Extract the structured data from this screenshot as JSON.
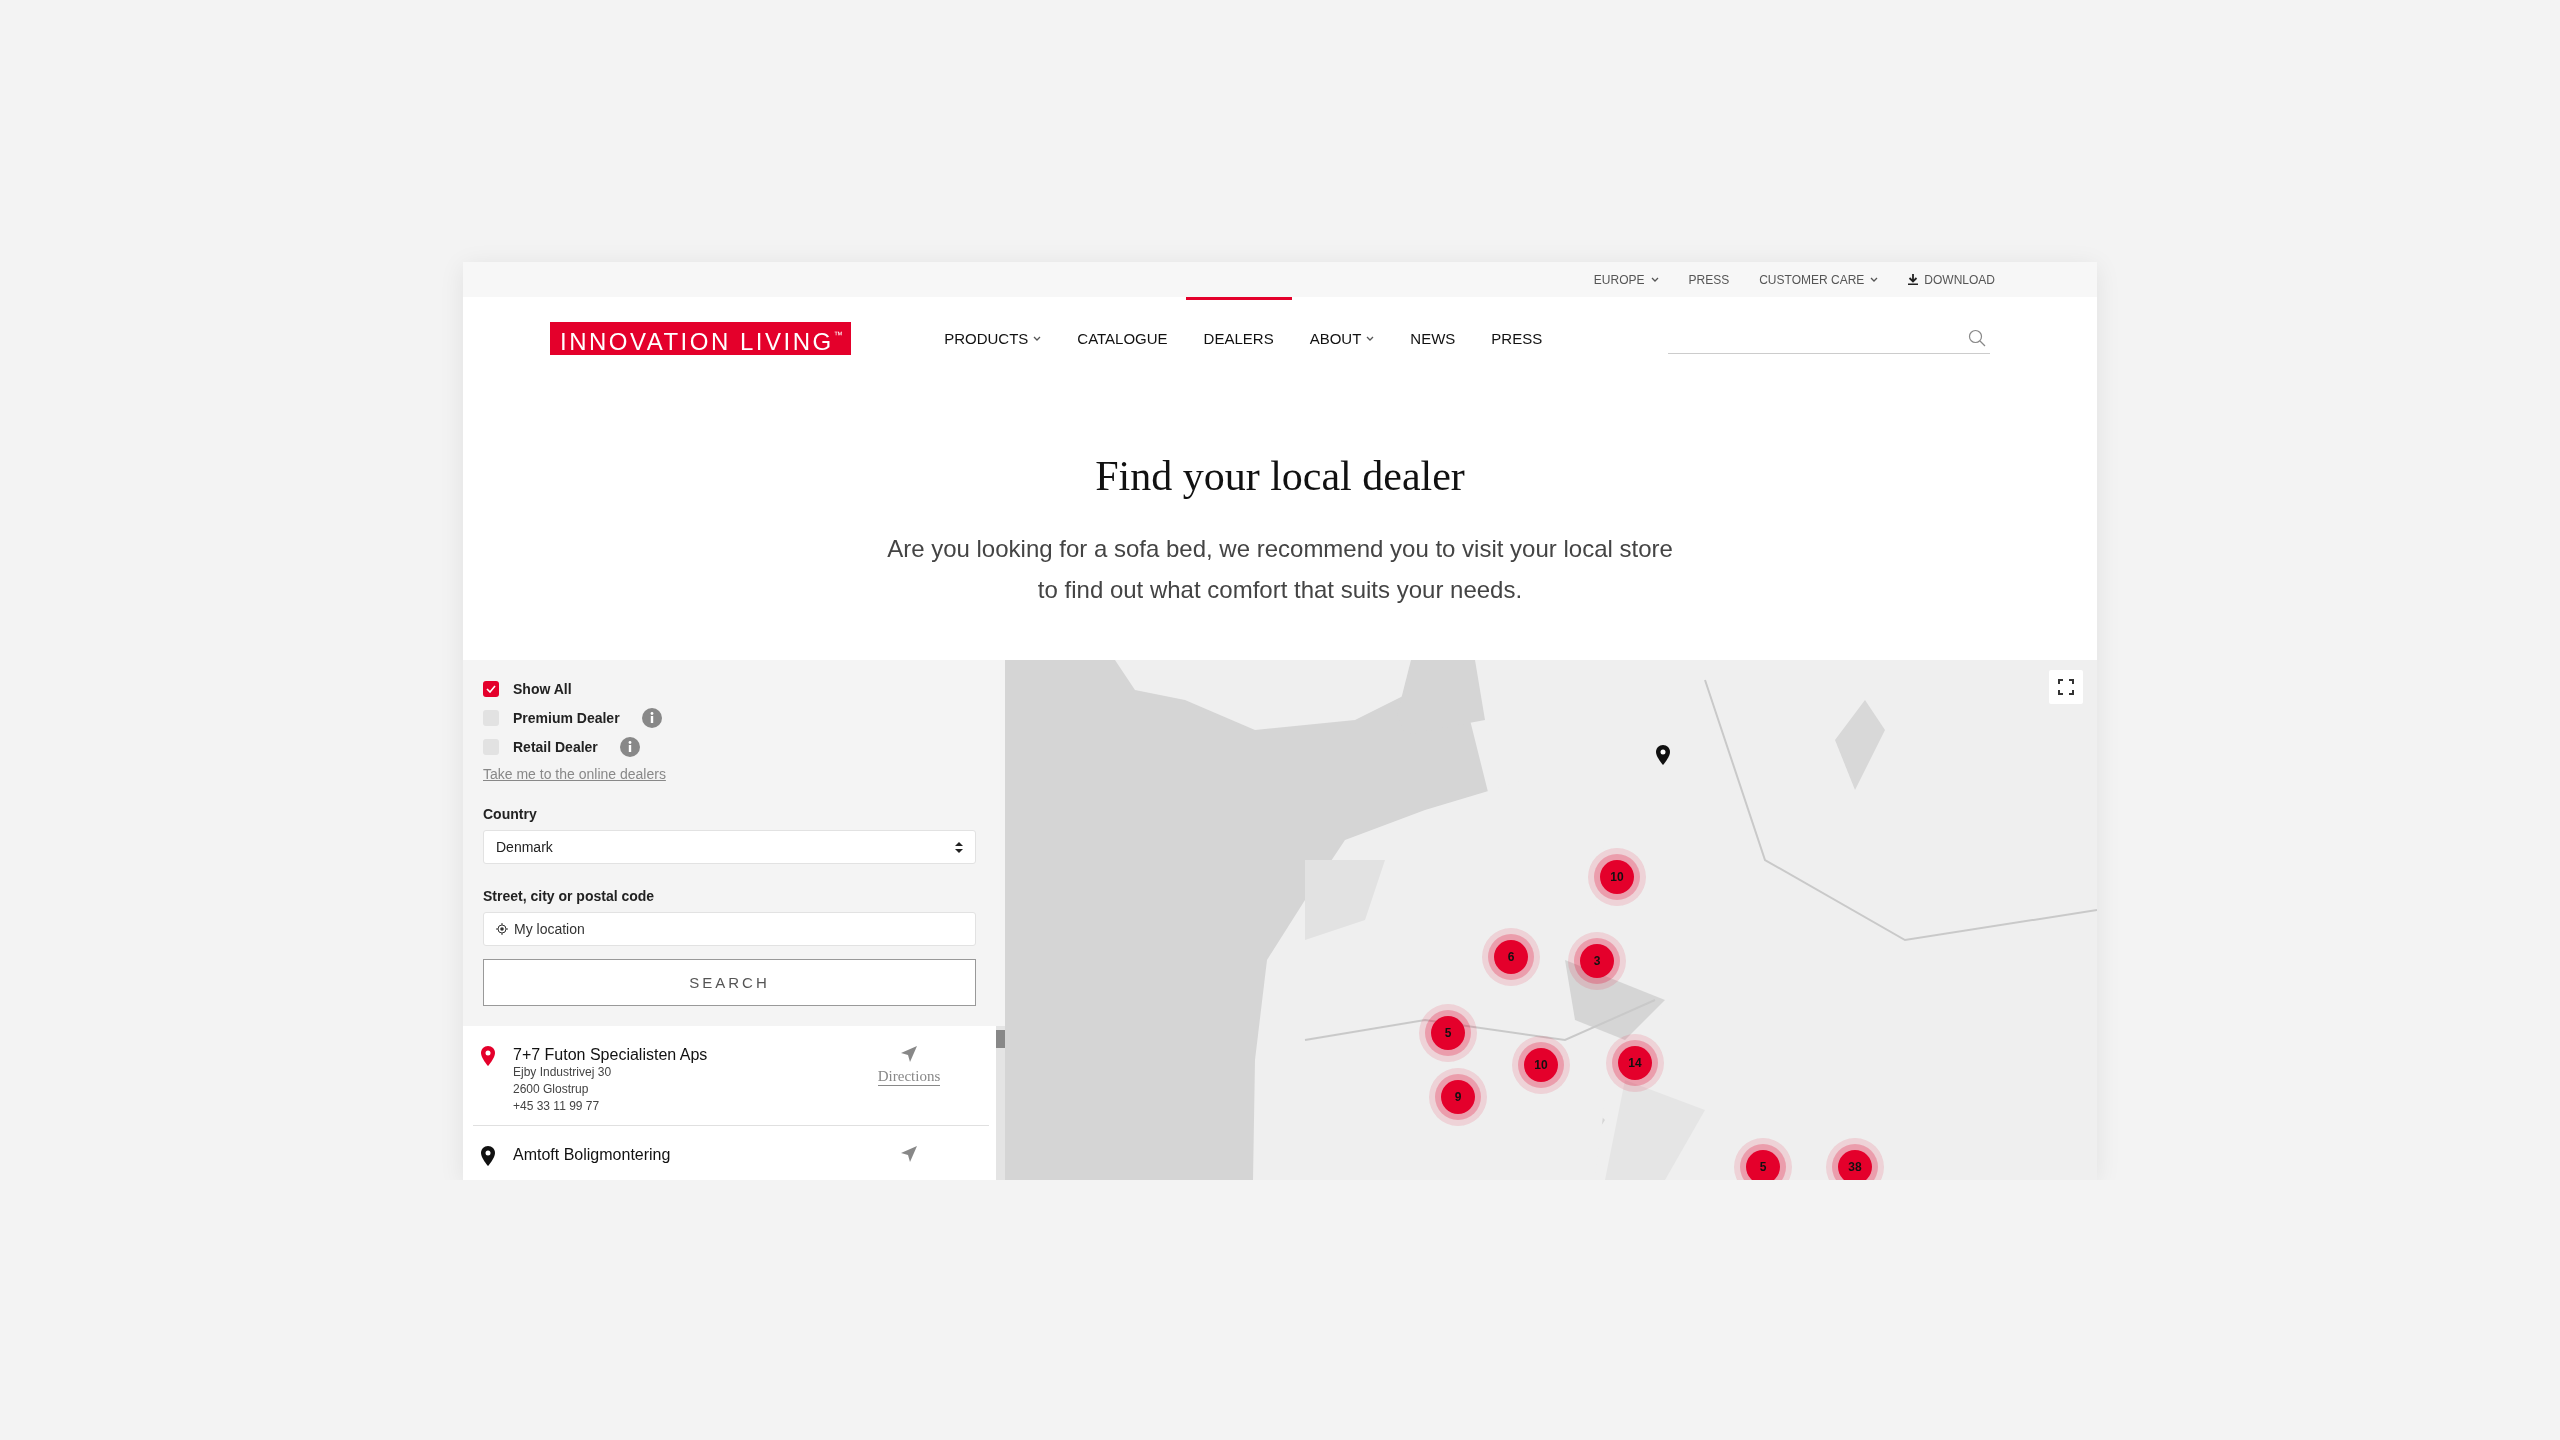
{
  "top_bar": {
    "links": [
      {
        "label": "EUROPE",
        "kind": "dropdown"
      },
      {
        "label": "PRESS",
        "kind": "link"
      },
      {
        "label": "CUSTOMER CARE",
        "kind": "dropdown"
      },
      {
        "label": "DOWNLOAD",
        "kind": "download"
      }
    ]
  },
  "nav": {
    "logo": "INNOVATION LIVING$^{™}$",
    "items": [
      {
        "label": "PRODUCTS",
        "dropdown": true,
        "selected": false
      },
      {
        "label": "CATALOGUE",
        "dropdown": false,
        "selected": false
      },
      {
        "label": "DEALERS",
        "dropdown": false,
        "selected": true
      },
      {
        "label": "ABOUT",
        "dropdown": true,
        "selected": false
      },
      {
        "label": "NEWS",
        "dropdown": false,
        "selected": false
      },
      {
        "label": "PRESS",
        "dropdown": false,
        "selected": false
      }
    ]
  },
  "hero": {
    "title": "Find your local dealer",
    "lines": [
      "Are you looking for a sofa bed, we recommend you to visit your local store",
      "to find out what comfort that suits your needs."
    ]
  },
  "filters": [
    {
      "label": "Show All",
      "checked": true,
      "info": false
    },
    {
      "label": "Premium Dealer",
      "checked": false,
      "info": true
    },
    {
      "label": "Retail Dealer",
      "checked": false,
      "info": true
    }
  ],
  "online_link": "Take me to the online dealers",
  "country": {
    "label": "Country",
    "value": "Denmark"
  },
  "address": {
    "label": "Street, city or postal code",
    "value": "My location"
  },
  "search_button": "SEARCH",
  "dealers": [
    {
      "name": "7+7 Futon Specialisten Aps",
      "address_lines": [
        "Ejby Industrivej 30",
        "2600 Glostrup",
        "+45 33 11 99 77"
      ],
      "directions": "Directions",
      "selected": true
    },
    {
      "name": "Amtoft Boligmontering",
      "selected": false
    }
  ],
  "map": {
    "clusters": [
      {
        "count": "10"
      },
      {
        "count": "6"
      },
      {
        "count": "3"
      },
      {
        "count": "5"
      },
      {
        "count": "10"
      },
      {
        "count": "14"
      },
      {
        "count": "9"
      },
      {
        "count": "5"
      },
      {
        "count": "38"
      }
    ]
  }
}
